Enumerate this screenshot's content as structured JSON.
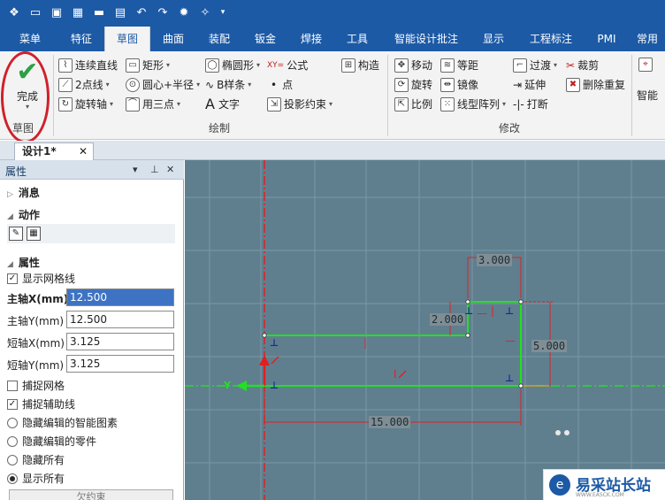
{
  "ribbon_tabs": [
    "菜单",
    "特征",
    "草图",
    "曲面",
    "装配",
    "钣金",
    "焊接",
    "工具",
    "智能设计批注",
    "显示",
    "工程标注",
    "PMI",
    "常用"
  ],
  "active_tab": "草图",
  "finish": {
    "label": "完成"
  },
  "groups": {
    "sketch": "草图",
    "draw": "绘制",
    "modify": "修改"
  },
  "draw_tools": {
    "polyline": "连续直线",
    "rectangle": "矩形",
    "ellipse": "椭圆形",
    "formula": "公式",
    "construct": "构造",
    "two_point": "2点线",
    "center_radius": "圆心+半径",
    "bspline": "B样条",
    "point": "点",
    "rotate_axis": "旋转轴",
    "three_point": "用三点",
    "text": "文字",
    "project_constraint": "投影约束",
    "formula_icon": "XY="
  },
  "modify_tools": {
    "move": "移动",
    "equal": "等距",
    "transition": "过渡",
    "trim": "裁剪",
    "rotate": "旋转",
    "mirror": "镜像",
    "extend": "延伸",
    "delete_dup": "删除重复",
    "scale": "比例",
    "pattern": "线型阵列",
    "break": "打断",
    "smart": "智能"
  },
  "doc_tab": {
    "label": "设计1*",
    "close": "✕"
  },
  "props": {
    "title": "属性",
    "messages": "消息",
    "action": "动作",
    "attributes": "属性",
    "show_grid": "显示网格线",
    "major_x_label": "主轴X(mm)",
    "major_x": "12.500",
    "major_y_label": "主轴Y(mm)",
    "major_y": "12.500",
    "minor_x_label": "短轴X(mm)",
    "minor_x": "3.125",
    "minor_y_label": "短轴Y(mm)",
    "minor_y": "3.125",
    "snap_grid": "捕捉网格",
    "snap_aux": "捕捉辅助线",
    "hide_smart": "隐藏编辑的智能图素",
    "hide_part": "隐藏编辑的零件",
    "hide_all": "隐藏所有",
    "show_all": "显示所有",
    "under_constrained": "欠约束"
  },
  "dimensions": {
    "d_top": "3.000",
    "d_left": "2.000",
    "d_right": "5.000",
    "d_bottom": "15.000"
  },
  "axis_label": "Y",
  "watermark": {
    "text": "易采站长站",
    "sub": "WWW.EASCK.COM"
  },
  "colors": {
    "title_bar": "#1c5aa6",
    "canvas": "#5f7f8f",
    "sketch_line": "#22e022",
    "axis_red": "#e02020",
    "finish_check": "#2ea043"
  }
}
